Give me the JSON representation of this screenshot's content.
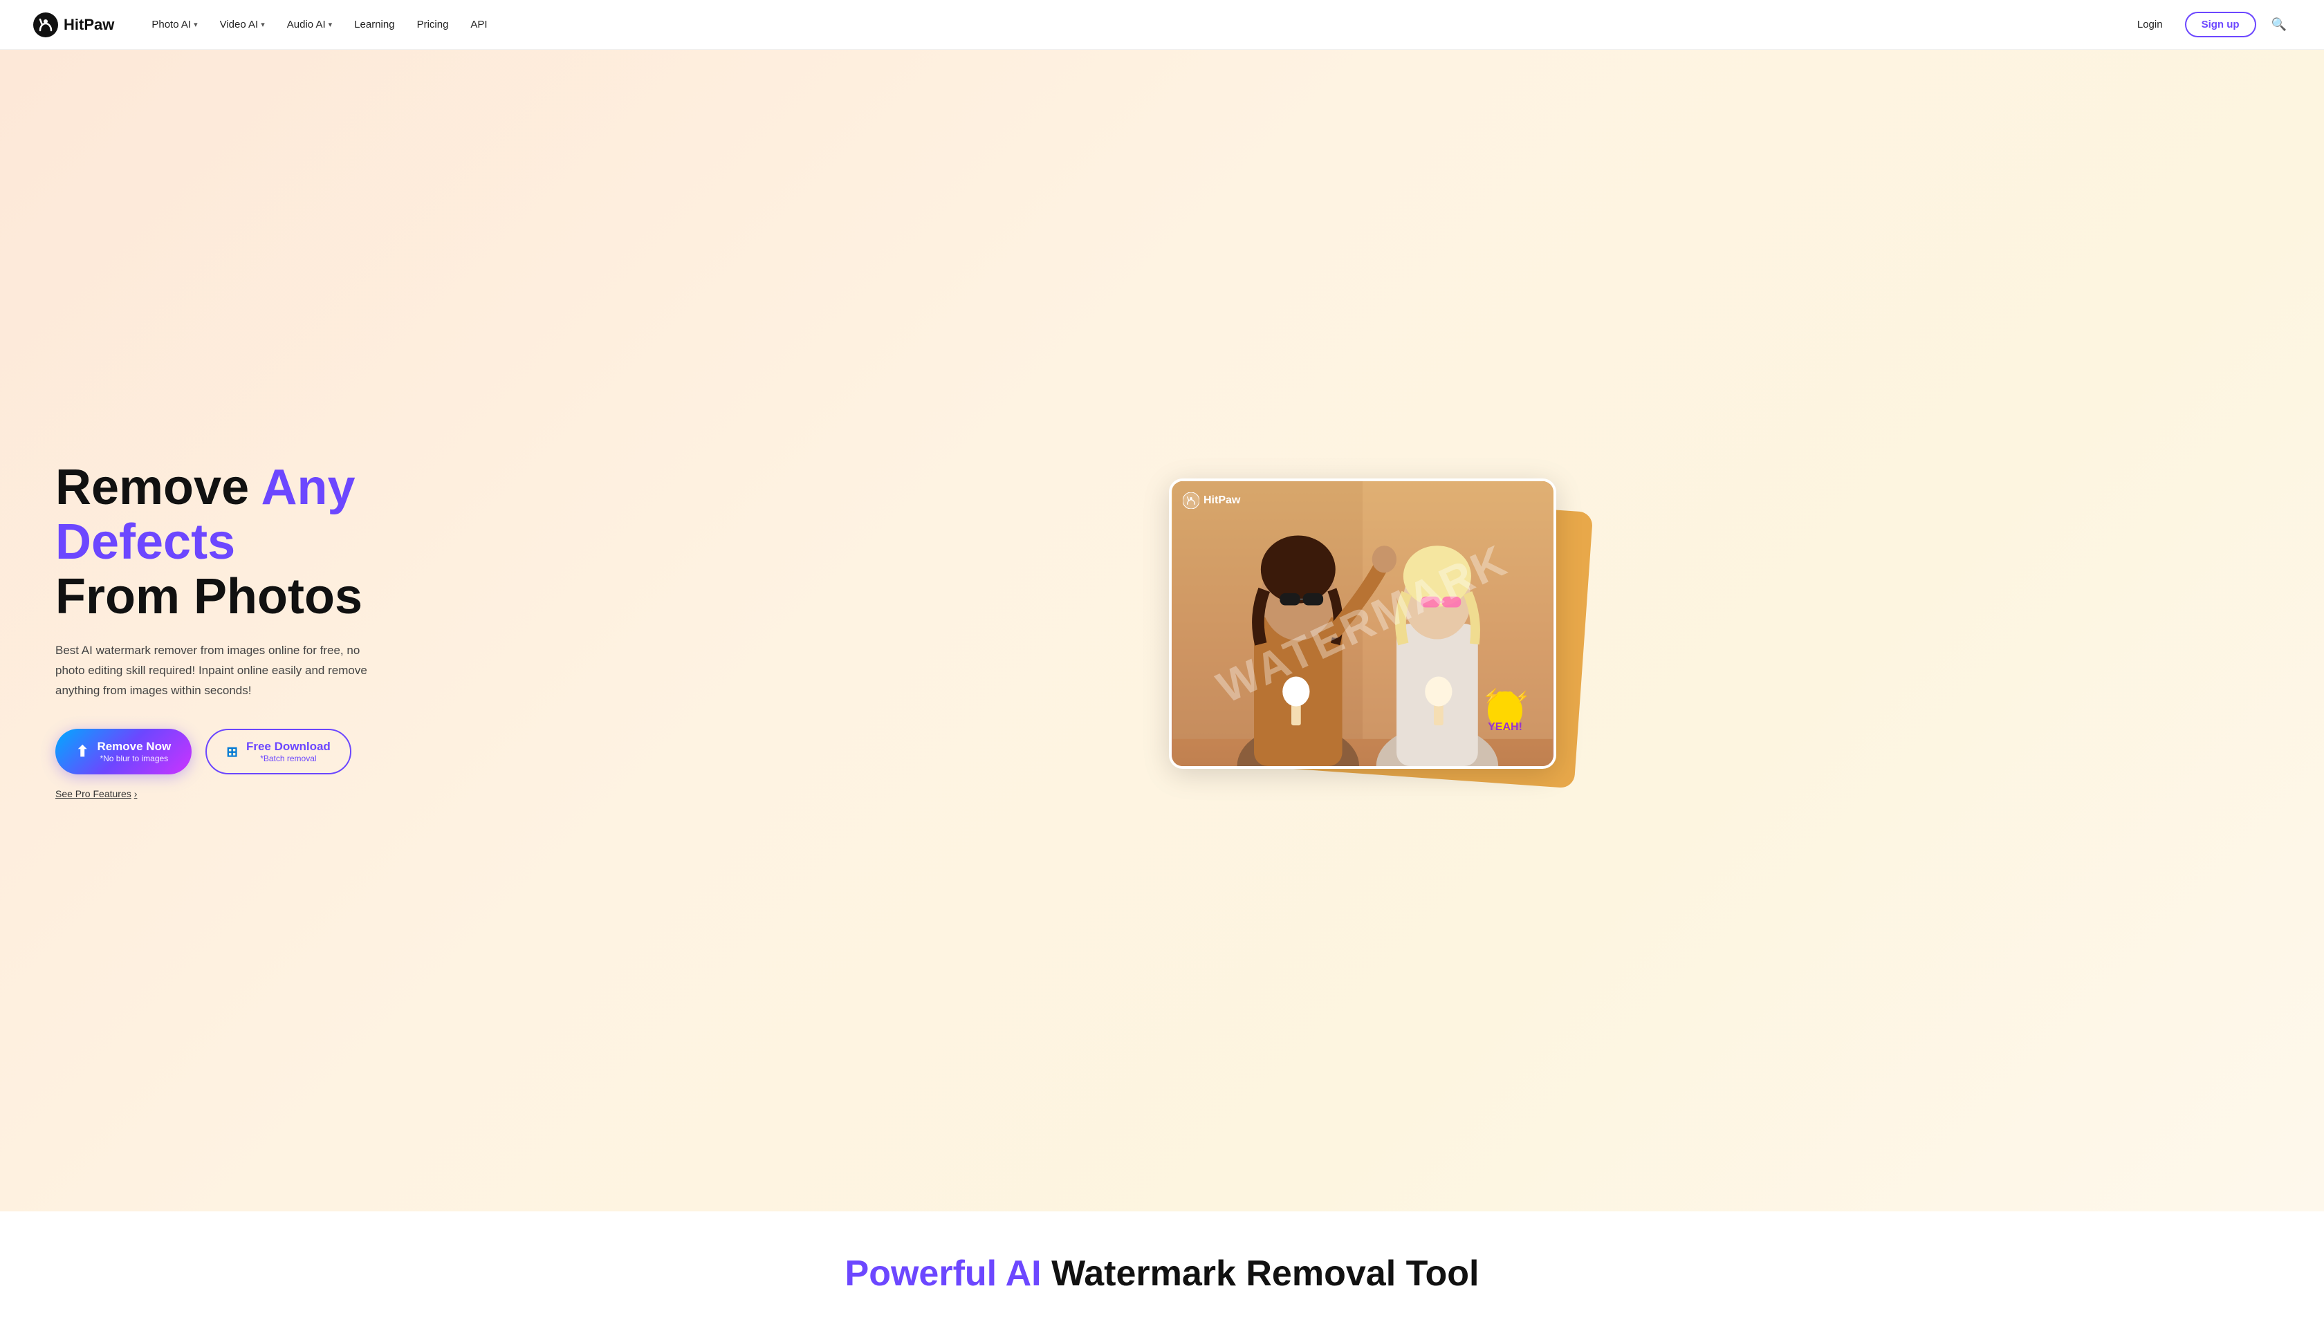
{
  "nav": {
    "logo_text": "HitPaw",
    "items": [
      {
        "label": "Photo AI",
        "has_chevron": true
      },
      {
        "label": "Video AI",
        "has_chevron": true
      },
      {
        "label": "Audio AI",
        "has_chevron": true
      },
      {
        "label": "Learning",
        "has_chevron": false
      },
      {
        "label": "Pricing",
        "has_chevron": false
      },
      {
        "label": "API",
        "has_chevron": false
      }
    ],
    "login_label": "Login",
    "signup_label": "Sign up"
  },
  "hero": {
    "title_plain": "Remove ",
    "title_accent": "Any Defects",
    "title_line2": "From Photos",
    "description": "Best AI watermark remover from images online for free, no photo editing skill required! Inpaint online easily and remove anything from images within seconds!",
    "remove_btn_label": "Remove Now",
    "remove_btn_sub": "*No blur to images",
    "download_btn_label": "Free Download",
    "download_btn_sub": "*Batch removal",
    "see_pro": "See Pro Features",
    "see_pro_arrow": "›",
    "watermark_text": "WATERMARK",
    "image_logo": "HitPaw",
    "sticker_emoji": "🤘"
  },
  "bottom": {
    "title_plain": "Powerful AI Watermark Removal Tool"
  }
}
